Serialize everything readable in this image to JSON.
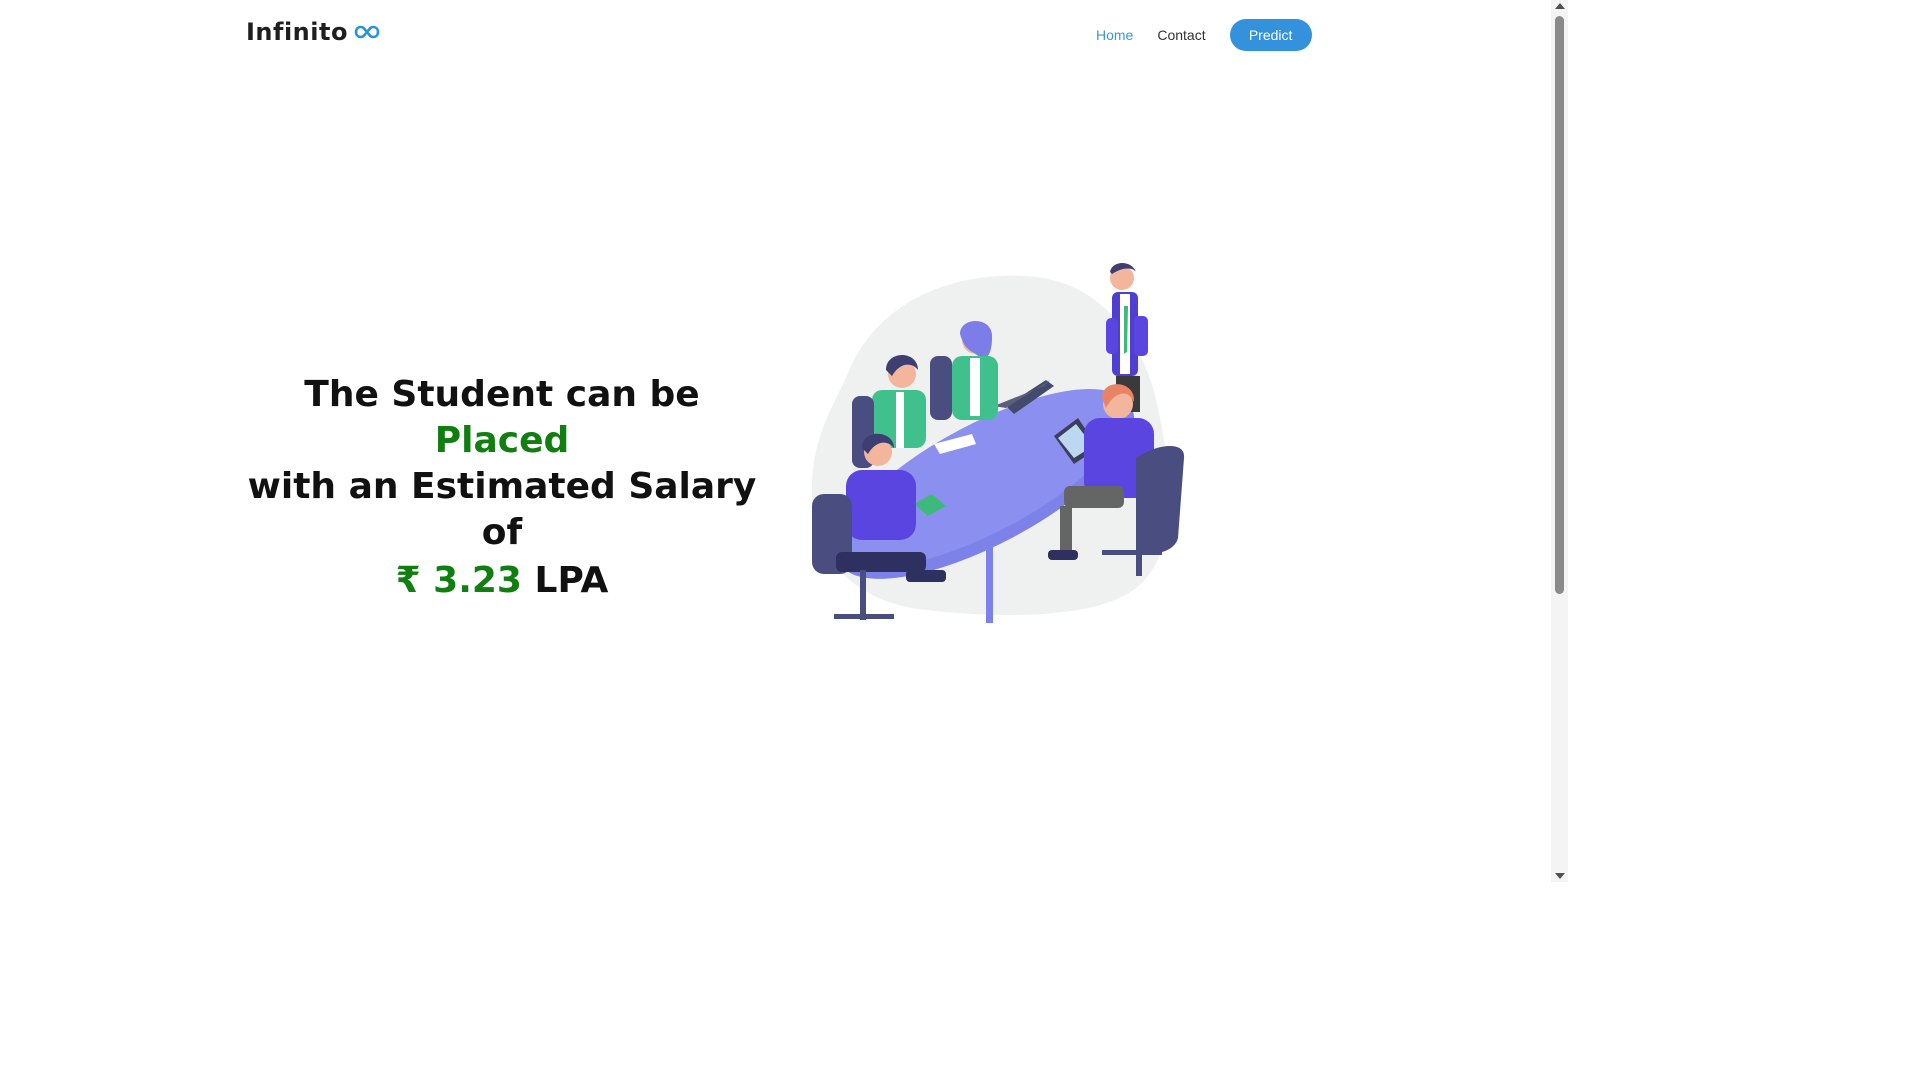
{
  "header": {
    "logo_text": "Infinito",
    "logo_icon": "infinity-icon",
    "nav": {
      "home": "Home",
      "contact": "Contact",
      "predict": "Predict"
    }
  },
  "hero": {
    "line1_prefix": "The Student can be ",
    "line1_status": "Placed",
    "line2": "with an Estimated Salary of",
    "salary_value": "₹ 3.23",
    "salary_unit": " LPA"
  },
  "illustration": {
    "icon": "team-meeting-illustration"
  },
  "colors": {
    "accent_blue": "#3392db",
    "success_green": "#117e10",
    "text_dark": "#111111"
  }
}
